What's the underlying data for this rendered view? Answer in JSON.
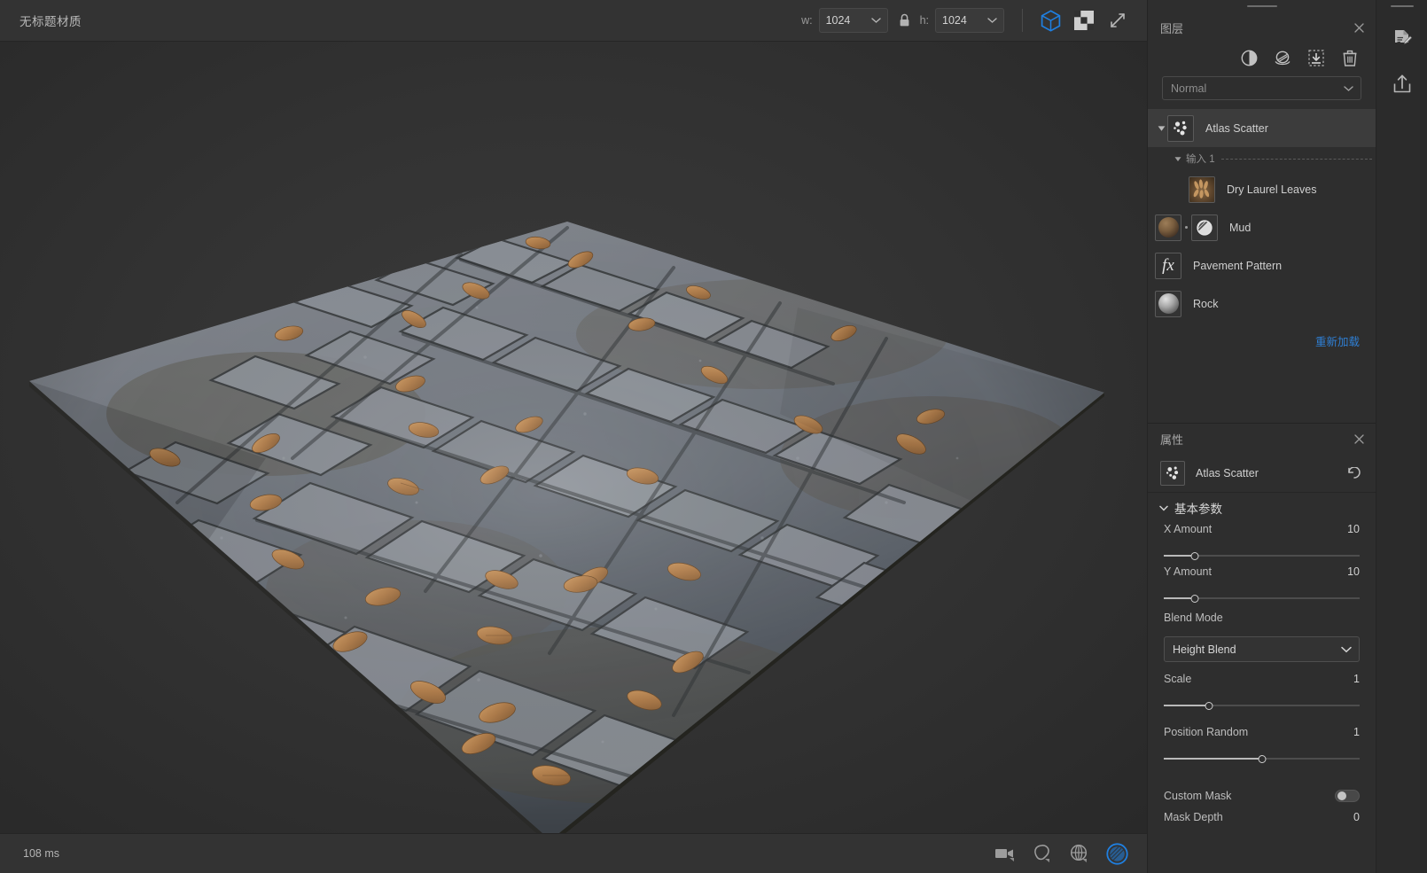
{
  "window": {
    "document_title": "无标题材质"
  },
  "toolbar": {
    "width_label": "w:",
    "width_value": "1024",
    "height_label": "h:",
    "height_value": "1024",
    "lock_icon": "lock-icon",
    "view_3d_icon": "cube-3d-icon",
    "view_2d_icon": "checker-2d-icon",
    "fullscreen_icon": "expand-arrows-icon",
    "accent_color": "#1f7fe0"
  },
  "statusbar": {
    "render_time": "108 ms",
    "icons": [
      {
        "name": "camera-icon"
      },
      {
        "name": "environment-shape-icon"
      },
      {
        "name": "globe-grid-icon"
      },
      {
        "name": "material-sphere-icon"
      }
    ],
    "active_icon_color": "#1f7fe0"
  },
  "layers_panel": {
    "title": "图层",
    "close_icon": "close-icon",
    "tools": [
      {
        "name": "add-fill-layer-icon"
      },
      {
        "name": "add-filter-layer-icon"
      },
      {
        "name": "import-layer-icon"
      },
      {
        "name": "delete-layer-icon"
      }
    ],
    "blend_mode": {
      "value": "Normal",
      "chevron_icon": "chevron-down-icon"
    },
    "items": [
      {
        "name": "Atlas Scatter",
        "thumb": "scatter-nodes-icon",
        "selected": true,
        "expanded": true,
        "has_disclosure": true
      },
      {
        "name": "Dry Laurel Leaves",
        "thumb": "leaves-thumbnail",
        "selected": false,
        "indent": true
      },
      {
        "name": "Mud",
        "thumb": "mud-sphere-thumbnail",
        "mask_thumb": "mask-icon",
        "selected": false
      },
      {
        "name": "Pavement Pattern",
        "thumb": "fx-filter-icon",
        "selected": false
      },
      {
        "name": "Rock",
        "thumb": "rock-sphere-thumbnail",
        "selected": false
      }
    ],
    "input_group": {
      "label": "输入 1",
      "triangle_icon": "triangle-down-icon"
    },
    "reload_label": "重新加载",
    "reload_color": "#2f7fd4"
  },
  "properties_panel": {
    "title": "属性",
    "close_icon": "close-icon",
    "node_name": "Atlas Scatter",
    "node_icon": "scatter-nodes-icon",
    "reset_icon": "undo-reset-icon",
    "section": {
      "label": "基本参数",
      "chevron_icon": "chevron-down-icon"
    },
    "params": [
      {
        "label": "X Amount",
        "value": "10",
        "type": "slider",
        "pct": 12
      },
      {
        "label": "Y Amount",
        "value": "10",
        "type": "slider",
        "pct": 12
      },
      {
        "label": "Blend Mode",
        "value": "Height Blend",
        "type": "select"
      },
      {
        "label": "Scale",
        "value": "1",
        "type": "slider",
        "pct": 22
      },
      {
        "label": "Position Random",
        "value": "1",
        "type": "slider",
        "pct": 50
      },
      {
        "label": "Custom Mask",
        "value": "",
        "type": "toggle",
        "on": false
      },
      {
        "label": "Mask Depth",
        "value": "0",
        "type": "cut"
      }
    ]
  },
  "rail": {
    "icons": [
      {
        "name": "edit-document-icon"
      },
      {
        "name": "export-share-icon"
      }
    ]
  }
}
